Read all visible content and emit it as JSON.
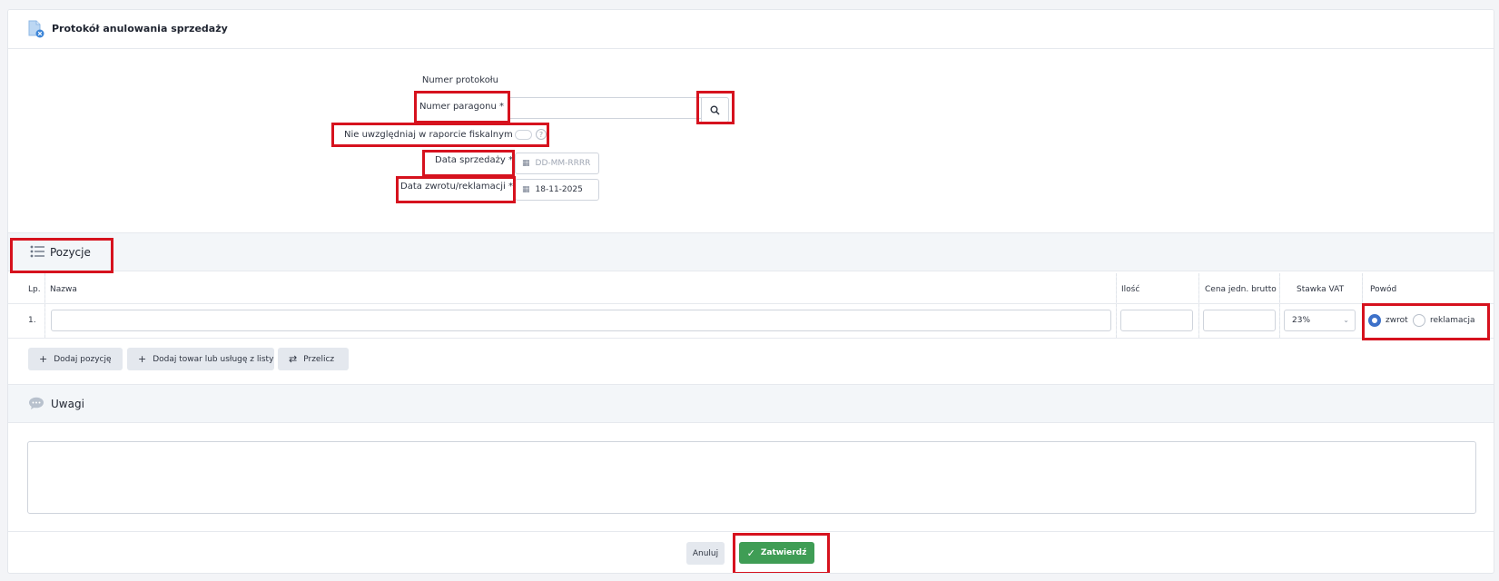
{
  "header": {
    "title": "Protokół anulowania sprzedaży"
  },
  "form": {
    "protocol_number_label": "Numer protokołu",
    "receipt_number_label": "Numer paragonu *",
    "receipt_number_value": "",
    "exclude_fiscal_label": "Nie uwzględniaj w raporcie fiskalnym",
    "help_icon": "?",
    "sale_date_label": "Data sprzedaży *",
    "sale_date_placeholder": "DD-MM-RRRR",
    "return_date_label": "Data zwrotu/reklamacji *",
    "return_date_value": "18-11-2025"
  },
  "positions": {
    "title": "Pozycje",
    "columns": [
      "Lp.",
      "Nazwa",
      "Ilość",
      "Cena jedn. brutto",
      "Stawka VAT",
      "Powód"
    ],
    "rows": [
      {
        "lp": "1.",
        "name": "",
        "qty": "",
        "price": "",
        "vat": "23%",
        "reason_return": "zwrot",
        "reason_complaint": "reklamacja",
        "selected": "zwrot"
      }
    ],
    "add_position": "Dodaj pozycję",
    "add_from_list": "Dodaj towar lub usługę z listy",
    "recalculate": "Przelicz"
  },
  "notes": {
    "title": "Uwagi",
    "value": ""
  },
  "footer": {
    "cancel": "Anuluj",
    "confirm": "Zatwierdź"
  },
  "colors": {
    "accent_blue": "#3d71c9",
    "confirm_green": "#3f9d55",
    "highlight_red": "#d6121e"
  }
}
